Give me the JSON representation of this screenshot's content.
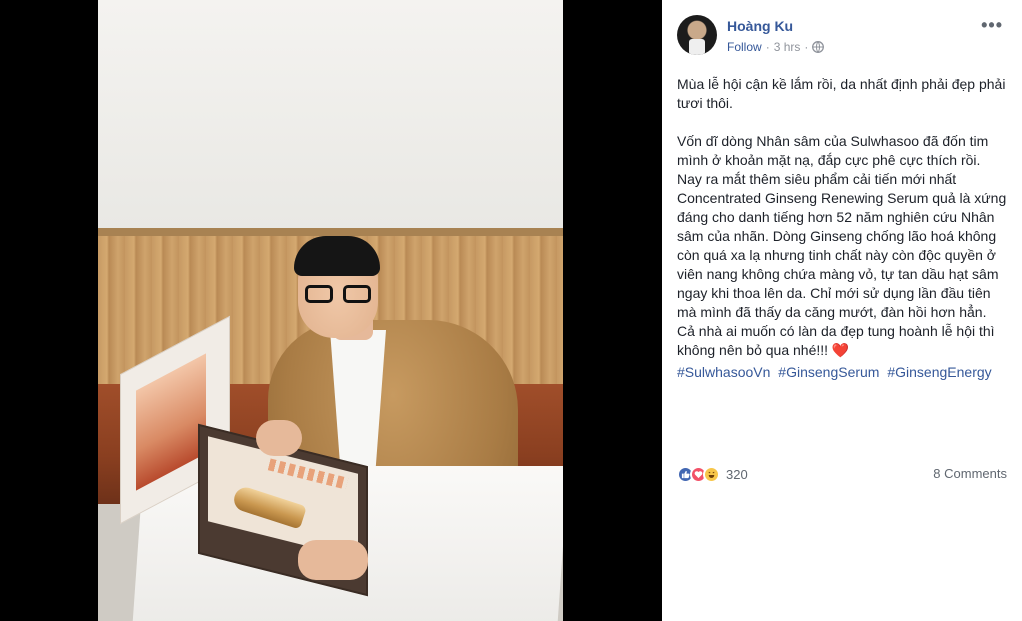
{
  "post": {
    "author": "Hoàng Ku",
    "follow_label": "Follow",
    "separator": "·",
    "time": "3 hrs",
    "more_icon": "more-icon",
    "privacy_icon": "globe-icon",
    "paragraph_1": "Mùa lễ hội cận kề lắm rồi, da nhất định phải đẹp phải tươi thôi.",
    "paragraph_2": "Vốn dĩ dòng Nhân sâm của Sulwhasoo đã đốn tim mình ở khoản mặt nạ, đắp cực phê cực thích rồi. Nay ra mắt thêm siêu phẩm cải tiến mới nhất Concentrated Ginseng Renewing Serum quả là xứng đáng cho danh tiếng hơn 52 năm nghiên cứu Nhân sâm của nhãn. Dòng Ginseng chống lão hoá không còn quá xa lạ nhưng tinh chất này còn độc quyền ở viên nang không chứa màng vỏ, tự tan dầu hạt sâm ngay khi thoa lên da. Chỉ mới sử dụng lần đầu tiên mà mình đã thấy da căng mướt, đàn hồi hơn hẳn. Cả nhà ai muốn có làn da đẹp tung hoành lễ hội thì không nên bỏ qua nhé!!!",
    "heart_emoji": "❤️",
    "hashtags": [
      "#SulwhasooVn",
      "#GinsengSerum",
      "#GinsengEnergy"
    ],
    "reaction_icons": [
      "like-icon",
      "love-icon",
      "haha-icon"
    ],
    "reaction_count": "320",
    "comments_label": "8 Comments"
  },
  "colors": {
    "link": "#365899",
    "text": "#1d2129",
    "muted": "#90949c",
    "like": "#4267b2",
    "love": "#f25268",
    "haha": "#f7c64a"
  }
}
